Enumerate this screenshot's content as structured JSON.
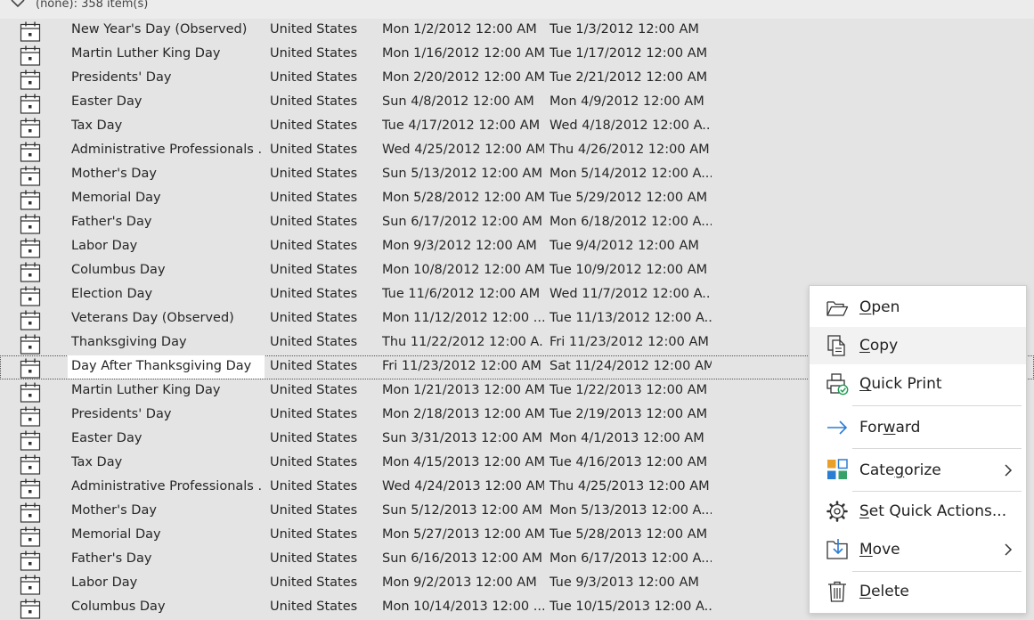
{
  "group": {
    "label": "(none): 358 item(s)"
  },
  "rows": [
    {
      "subject": "New Year's Day (Observed)",
      "location": "United States",
      "start": "Mon 1/2/2012 12:00 AM",
      "end": "Tue 1/3/2012 12:00 AM"
    },
    {
      "subject": "Martin Luther King Day",
      "location": "United States",
      "start": "Mon 1/16/2012 12:00 AM",
      "end": "Tue 1/17/2012 12:00 AM"
    },
    {
      "subject": "Presidents' Day",
      "location": "United States",
      "start": "Mon 2/20/2012 12:00 AM",
      "end": "Tue 2/21/2012 12:00 AM"
    },
    {
      "subject": "Easter Day",
      "location": "United States",
      "start": "Sun 4/8/2012 12:00 AM",
      "end": "Mon 4/9/2012 12:00 AM"
    },
    {
      "subject": "Tax Day",
      "location": "United States",
      "start": "Tue 4/17/2012 12:00 AM",
      "end": "Wed 4/18/2012 12:00 A..."
    },
    {
      "subject": "Administrative Professionals ...",
      "location": "United States",
      "start": "Wed 4/25/2012 12:00 AM",
      "end": "Thu 4/26/2012 12:00 AM"
    },
    {
      "subject": "Mother's Day",
      "location": "United States",
      "start": "Sun 5/13/2012 12:00 AM",
      "end": "Mon 5/14/2012 12:00 A..."
    },
    {
      "subject": "Memorial Day",
      "location": "United States",
      "start": "Mon 5/28/2012 12:00 AM",
      "end": "Tue 5/29/2012 12:00 AM"
    },
    {
      "subject": "Father's Day",
      "location": "United States",
      "start": "Sun 6/17/2012 12:00 AM",
      "end": "Mon 6/18/2012 12:00 A..."
    },
    {
      "subject": "Labor Day",
      "location": "United States",
      "start": "Mon 9/3/2012 12:00 AM",
      "end": "Tue 9/4/2012 12:00 AM"
    },
    {
      "subject": "Columbus Day",
      "location": "United States",
      "start": "Mon 10/8/2012 12:00 AM",
      "end": "Tue 10/9/2012 12:00 AM"
    },
    {
      "subject": "Election Day",
      "location": "United States",
      "start": "Tue 11/6/2012 12:00 AM",
      "end": "Wed 11/7/2012 12:00 A..."
    },
    {
      "subject": "Veterans Day (Observed)",
      "location": "United States",
      "start": "Mon 11/12/2012 12:00 ...",
      "end": "Tue 11/13/2012 12:00 A..."
    },
    {
      "subject": "Thanksgiving Day",
      "location": "United States",
      "start": "Thu 11/22/2012 12:00 A...",
      "end": "Fri 11/23/2012 12:00 AM"
    },
    {
      "subject": "Day After Thanksgiving Day",
      "location": "United States",
      "start": "Fri 11/23/2012 12:00 AM",
      "end": "Sat 11/24/2012 12:00 AM"
    },
    {
      "subject": "Martin Luther King Day",
      "location": "United States",
      "start": "Mon 1/21/2013 12:00 AM",
      "end": "Tue 1/22/2013 12:00 AM"
    },
    {
      "subject": "Presidents' Day",
      "location": "United States",
      "start": "Mon 2/18/2013 12:00 AM",
      "end": "Tue 2/19/2013 12:00 AM"
    },
    {
      "subject": "Easter Day",
      "location": "United States",
      "start": "Sun 3/31/2013 12:00 AM",
      "end": "Mon 4/1/2013 12:00 AM"
    },
    {
      "subject": "Tax Day",
      "location": "United States",
      "start": "Mon 4/15/2013 12:00 AM",
      "end": "Tue 4/16/2013 12:00 AM"
    },
    {
      "subject": "Administrative Professionals ...",
      "location": "United States",
      "start": "Wed 4/24/2013 12:00 AM",
      "end": "Thu 4/25/2013 12:00 AM"
    },
    {
      "subject": "Mother's Day",
      "location": "United States",
      "start": "Sun 5/12/2013 12:00 AM",
      "end": "Mon 5/13/2013 12:00 A..."
    },
    {
      "subject": "Memorial Day",
      "location": "United States",
      "start": "Mon 5/27/2013 12:00 AM",
      "end": "Tue 5/28/2013 12:00 AM"
    },
    {
      "subject": "Father's Day",
      "location": "United States",
      "start": "Sun 6/16/2013 12:00 AM",
      "end": "Mon 6/17/2013 12:00 A..."
    },
    {
      "subject": "Labor Day",
      "location": "United States",
      "start": "Mon 9/2/2013 12:00 AM",
      "end": "Tue 9/3/2013 12:00 AM"
    },
    {
      "subject": "Columbus Day",
      "location": "United States",
      "start": "Mon 10/14/2013 12:00 ...",
      "end": "Tue 10/15/2013 12:00 A..."
    }
  ],
  "focused_row": 14,
  "context_menu": {
    "items": [
      {
        "id": "open",
        "ul": "O",
        "rest": "pen",
        "icon": "folder-open-icon"
      },
      {
        "id": "copy",
        "ul": "C",
        "rest": "opy",
        "icon": "copy-icon"
      },
      {
        "id": "quick-print",
        "ul": "Q",
        "rest": "uick Print",
        "icon": "quick-print-icon"
      },
      {
        "id": "forward",
        "pre": "For",
        "ul": "w",
        "rest": "ard",
        "icon": "forward-arrow-icon"
      },
      {
        "id": "categorize",
        "pre": "Cate",
        "ul": "g",
        "rest": "orize",
        "icon": "categorize-icon",
        "submenu": true
      },
      {
        "id": "set-quick-actions",
        "ul": "S",
        "rest": "et Quick Actions...",
        "icon": "gear-icon"
      },
      {
        "id": "move",
        "ul": "M",
        "rest": "ove",
        "icon": "move-icon",
        "submenu": true
      },
      {
        "id": "delete",
        "ul": "D",
        "rest": "elete",
        "icon": "trash-icon"
      }
    ]
  },
  "colors": {
    "list_background": "#e4e4e4",
    "menu_background": "#ffffff",
    "forward_arrow": "#2b7cd3",
    "categorize": [
      "#e8a02a",
      "#2b7cd3",
      "#2b7cd3",
      "#38a169"
    ],
    "check_badge": "#1f9d55"
  }
}
